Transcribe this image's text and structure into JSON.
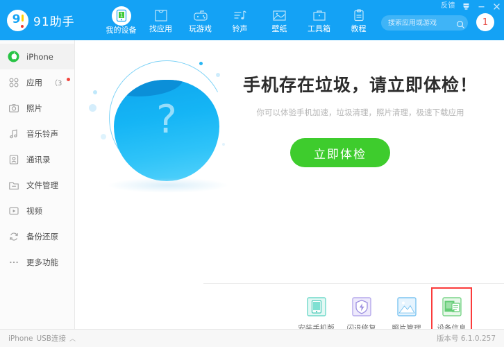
{
  "window": {
    "feedback_label": "反馈",
    "theme_icon": "download-tray-icon",
    "minimize_icon": "minimize-icon",
    "close_icon": "close-icon",
    "brand_color": "#14a2f5"
  },
  "logo": {
    "mark": "9",
    "text": "91助手"
  },
  "nav": {
    "items": [
      {
        "label": "我的设备",
        "icon": "device-icon",
        "active": true
      },
      {
        "label": "找应用",
        "icon": "app-bag-icon",
        "active": false
      },
      {
        "label": "玩游戏",
        "icon": "gamepad-icon",
        "active": false
      },
      {
        "label": "铃声",
        "icon": "music-note-icon",
        "active": false
      },
      {
        "label": "壁纸",
        "icon": "wallpaper-icon",
        "active": false
      },
      {
        "label": "工具箱",
        "icon": "toolbox-icon",
        "active": false
      },
      {
        "label": "教程",
        "icon": "tutorial-icon",
        "active": false
      }
    ]
  },
  "search": {
    "placeholder": "搜索应用或游戏",
    "value": "",
    "icon": "search-icon"
  },
  "account": {
    "badge": "1"
  },
  "sidebar": {
    "items": [
      {
        "label": "iPhone",
        "icon": "apple-icon",
        "active": true,
        "count": "",
        "dot": false
      },
      {
        "label": "应用",
        "icon": "apps-grid-icon",
        "active": false,
        "count": "（3",
        "dot": true
      },
      {
        "label": "照片",
        "icon": "camera-icon",
        "active": false,
        "count": "",
        "dot": false
      },
      {
        "label": "音乐铃声",
        "icon": "music-icon",
        "active": false,
        "count": "",
        "dot": false
      },
      {
        "label": "通讯录",
        "icon": "contacts-icon",
        "active": false,
        "count": "",
        "dot": false
      },
      {
        "label": "文件管理",
        "icon": "folder-icon",
        "active": false,
        "count": "",
        "dot": false
      },
      {
        "label": "视频",
        "icon": "video-icon",
        "active": false,
        "count": "",
        "dot": false
      },
      {
        "label": "备份还原",
        "icon": "refresh-icon",
        "active": false,
        "count": "",
        "dot": false
      },
      {
        "label": "更多功能",
        "icon": "ellipsis-icon",
        "active": false,
        "count": "",
        "dot": false
      }
    ]
  },
  "hero": {
    "title": "手机存在垃圾，请立即体检！",
    "subtitle": "你可以体验手机加速，垃圾清理，照片清理，极速下载应用",
    "cta_label": "立即体检",
    "cta_color": "#3ecc2d",
    "sphere_glyph": "?"
  },
  "shortcuts": {
    "items": [
      {
        "label": "安装手机版",
        "icon": "phone-install-icon",
        "color": "#4ed3c1",
        "selected": false
      },
      {
        "label": "闪退修复",
        "icon": "shield-bolt-icon",
        "color": "#9b8ee0",
        "selected": false
      },
      {
        "label": "照片管理",
        "icon": "photo-icon",
        "color": "#5bb7ef",
        "selected": false
      },
      {
        "label": "设备信息",
        "icon": "device-info-icon",
        "color": "#5ecb6e",
        "selected": true
      }
    ],
    "selection_color": "#fb3b3b"
  },
  "statusbar": {
    "device": "iPhone",
    "connection": "USB连接",
    "caret": "︿",
    "version": "版本号 6.1.0.257"
  }
}
